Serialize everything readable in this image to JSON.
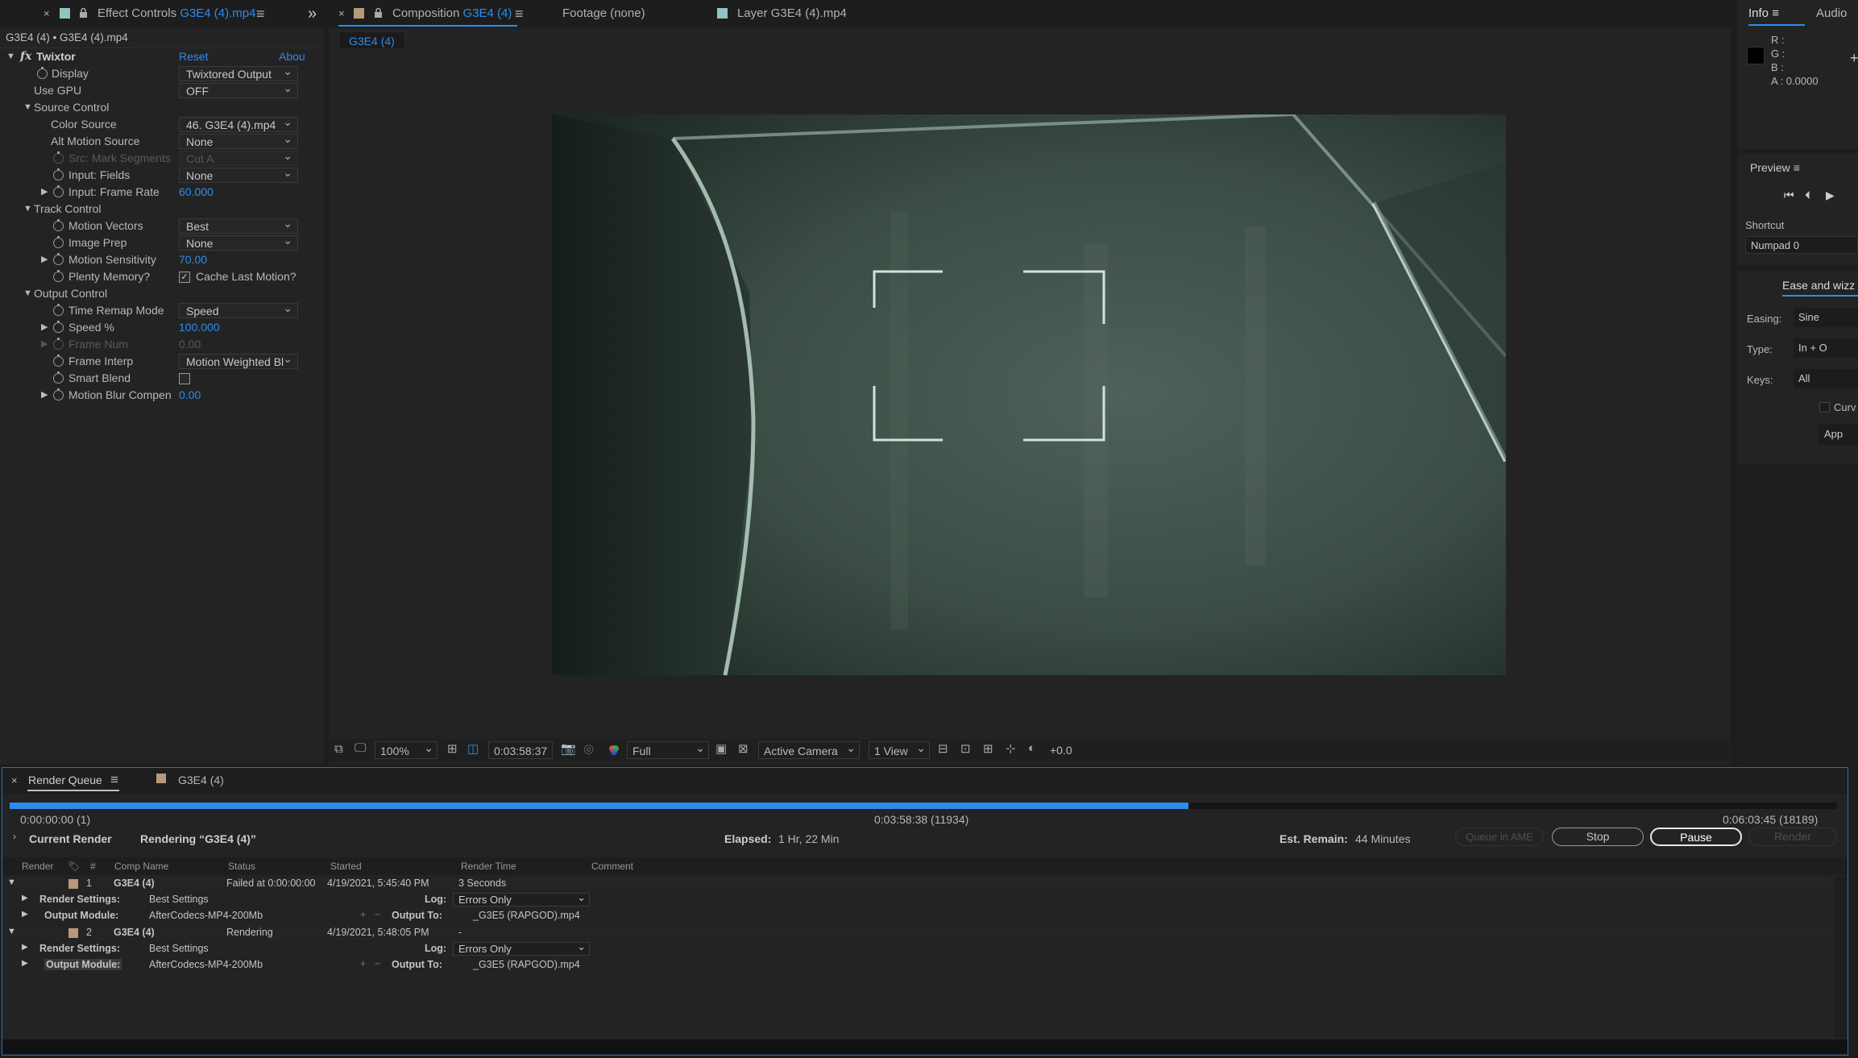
{
  "effect_controls": {
    "close": "×",
    "tab_prefix": "Effect Controls",
    "tab_file": "G3E4 (4).mp4",
    "menu": "≡",
    "expand": "»",
    "breadcrumb": "G3E4 (4) • G3E4 (4).mp4",
    "fx": "fx",
    "effect_name": "Twixtor",
    "reset": "Reset",
    "about": "Abou",
    "rows": {
      "display": {
        "label": "Display",
        "value": "Twixtored Output"
      },
      "use_gpu": {
        "label": "Use GPU",
        "value": "OFF"
      },
      "source_control": {
        "label": "Source Control"
      },
      "color_source": {
        "label": "Color Source",
        "value": "46. G3E4 (4).mp4"
      },
      "alt_motion": {
        "label": "Alt Motion Source",
        "value": "None"
      },
      "mark_segments": {
        "label": "Src: Mark Segments",
        "value": "Cut A"
      },
      "input_fields": {
        "label": "Input: Fields",
        "value": "None"
      },
      "frame_rate": {
        "label": "Input: Frame Rate",
        "value": "60.000"
      },
      "track_control": {
        "label": "Track Control"
      },
      "motion_vectors": {
        "label": "Motion Vectors",
        "value": "Best"
      },
      "image_prep": {
        "label": "Image Prep",
        "value": "None"
      },
      "motion_sensitivity": {
        "label": "Motion Sensitivity",
        "value": "70.00"
      },
      "plenty_memory": {
        "label": "Plenty Memory?",
        "value": "Cache Last Motion?"
      },
      "output_control": {
        "label": "Output Control"
      },
      "time_remap": {
        "label": "Time Remap Mode",
        "value": "Speed"
      },
      "speed": {
        "label": "Speed %",
        "value": "100.000"
      },
      "frame_num": {
        "label": "Frame Num",
        "value": "0.00"
      },
      "frame_interp": {
        "label": "Frame Interp",
        "value": "Motion Weighted Bl"
      },
      "smart_blend": {
        "label": "Smart Blend"
      },
      "motion_blur": {
        "label": "Motion Blur Compen",
        "value": "0.00"
      }
    }
  },
  "composition": {
    "close": "×",
    "tab_prefix": "Composition",
    "tab_name": "G3E4 (4)",
    "menu": "≡",
    "footage_tab": "Footage (none)",
    "layer_tab": "Layer  G3E4 (4).mp4",
    "subtab": "G3E4 (4)",
    "zoom": "100%",
    "timecode": "0:03:58:37",
    "resolution": "Full",
    "camera": "Active Camera",
    "view": "1 View",
    "exposure": "+0.0"
  },
  "info": {
    "tab": "Info",
    "menu": "≡",
    "audio_tab": "Audio",
    "r": "R :",
    "g": "G :",
    "b": "B :",
    "a": "A :  0.0000",
    "plus": "+"
  },
  "preview": {
    "title": "Preview",
    "menu": "≡",
    "shortcut_label": "Shortcut",
    "shortcut_value": "Numpad 0"
  },
  "ease": {
    "tab": "Ease and wizz",
    "easing_label": "Easing:",
    "easing_value": "Sine",
    "type_label": "Type:",
    "type_value": "In + O",
    "keys_label": "Keys:",
    "keys_value": "All",
    "curve": "Curv",
    "apply": "App"
  },
  "render_queue": {
    "close": "×",
    "tab": "Render Queue",
    "menu": "≡",
    "comp_tab": "G3E4 (4)",
    "progress_fraction": 0.645,
    "time_start": "0:00:00:00 (1)",
    "time_current": "0:03:58:38 (11934)",
    "time_end": "0:06:03:45 (18189)",
    "current_render_label": "Current Render",
    "rendering_text": "Rendering “G3E4 (4)”",
    "elapsed_label": "Elapsed:",
    "elapsed_value": "1 Hr, 22 Min",
    "remain_label": "Est. Remain:",
    "remain_value": "44 Minutes",
    "queue_ame": "Queue in AME",
    "stop": "Stop",
    "pause": "Pause",
    "render": "Render",
    "columns": {
      "render": "Render",
      "num": "#",
      "comp": "Comp Name",
      "status": "Status",
      "started": "Started",
      "render_time": "Render Time",
      "comment": "Comment"
    },
    "items": [
      {
        "num": "1",
        "comp": "G3E4 (4)",
        "status": "Failed at 0:00:00:00",
        "started": "4/19/2021, 5:45:40 PM",
        "render_time": "3 Seconds",
        "rs_label": "Render Settings:",
        "rs_value": "Best Settings",
        "log_label": "Log:",
        "log_value": "Errors Only",
        "om_label": "Output Module:",
        "om_value": "AfterCodecs-MP4-200Mb",
        "out_label": "Output To:",
        "out_value": "_G3E5 (RAPGOD).mp4"
      },
      {
        "num": "2",
        "comp": "G3E4 (4)",
        "status": "Rendering",
        "started": "4/19/2021, 5:48:05 PM",
        "render_time": "-",
        "rs_label": "Render Settings:",
        "rs_value": "Best Settings",
        "log_label": "Log:",
        "log_value": "Errors Only",
        "om_label": "Output Module:",
        "om_value": "AfterCodecs-MP4-200Mb",
        "out_label": "Output To:",
        "out_value": "_G3E5 (RAPGOD).mp4"
      }
    ]
  },
  "colors": {
    "accent": "#2d8ceb",
    "label_tan": "#b79a78",
    "label_teal": "#8fc4c0"
  }
}
